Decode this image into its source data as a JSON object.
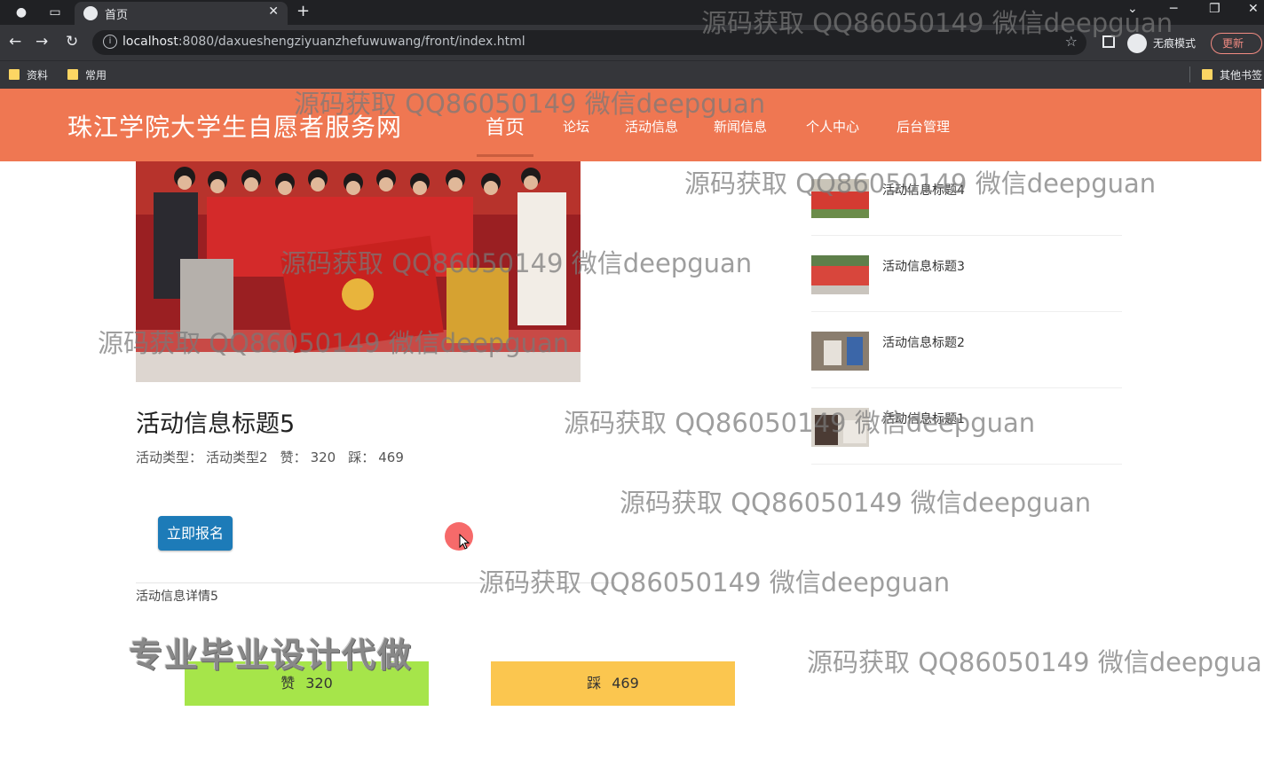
{
  "browser": {
    "tab_title": "首页",
    "url_host": "localhost",
    "url_rest": ":8080/daxueshengziyuanzhefuwuwang/front/index.html",
    "incognito_label": "无痕模式",
    "update_label": "更新",
    "bookmarks": [
      "资料",
      "常用",
      "其他书签"
    ],
    "icons": [
      "back-icon",
      "forward-icon",
      "reload-icon",
      "info-icon",
      "star-icon",
      "new-tab-icon",
      "close-icon"
    ]
  },
  "header": {
    "site_title": "珠江学院大学生自愿者服务网",
    "nav": [
      "首页",
      "论坛",
      "活动信息",
      "新闻信息",
      "个人中心",
      "后台管理"
    ],
    "accent_color": "#ef7752"
  },
  "detail": {
    "title": "活动信息标题5",
    "type_label": "活动类型：",
    "type_value": "活动类型2",
    "like_label": "赞：",
    "like_count": "320",
    "dislike_label": "踩：",
    "dislike_count": "469",
    "signup_label": "立即报名",
    "content": "活动信息详情5",
    "like_btn_label": "赞",
    "dislike_btn_label": "踩"
  },
  "banner": {
    "text": "专业毕业设计代做"
  },
  "sidebar": {
    "items": [
      {
        "label": "活动信息标题4"
      },
      {
        "label": "活动信息标题3"
      },
      {
        "label": "活动信息标题2"
      },
      {
        "label": "活动信息标题1"
      }
    ]
  },
  "watermark": {
    "text": "源码获取 QQ86050149 微信deepguan",
    "text_short": "源码获取 QQ86050149 微信deepgua"
  }
}
